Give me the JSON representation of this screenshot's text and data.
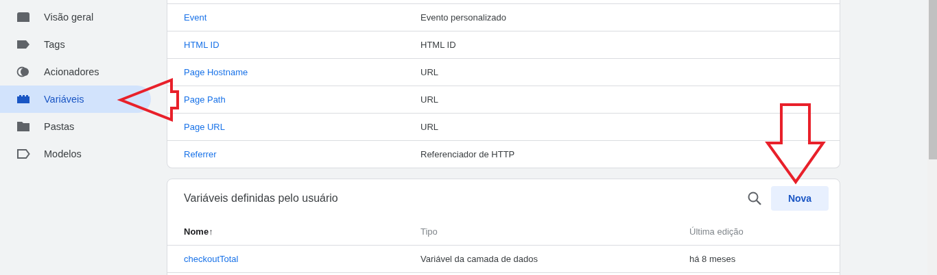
{
  "sidebar": {
    "items": [
      {
        "label": "Visão geral",
        "selected": false
      },
      {
        "label": "Tags",
        "selected": false
      },
      {
        "label": "Acionadores",
        "selected": false
      },
      {
        "label": "Variáveis",
        "selected": true
      },
      {
        "label": "Pastas",
        "selected": false
      },
      {
        "label": "Modelos",
        "selected": false
      }
    ]
  },
  "builtin_variables": {
    "rows": [
      {
        "name": "Event",
        "type": "Evento personalizado"
      },
      {
        "name": "HTML ID",
        "type": "HTML ID"
      },
      {
        "name": "Page Hostname",
        "type": "URL"
      },
      {
        "name": "Page Path",
        "type": "URL"
      },
      {
        "name": "Page URL",
        "type": "URL"
      },
      {
        "name": "Referrer",
        "type": "Referenciador de HTTP"
      }
    ]
  },
  "user_variables": {
    "title": "Variáveis definidas pelo usuário",
    "button": "Nova",
    "columns": [
      {
        "label": "Nome",
        "sort": "↑"
      },
      {
        "label": "Tipo"
      },
      {
        "label": "Última edição"
      }
    ],
    "rows": [
      {
        "name": "checkoutTotal",
        "type": "Variável da camada de dados",
        "last_edit": "há 8 meses"
      }
    ]
  }
}
